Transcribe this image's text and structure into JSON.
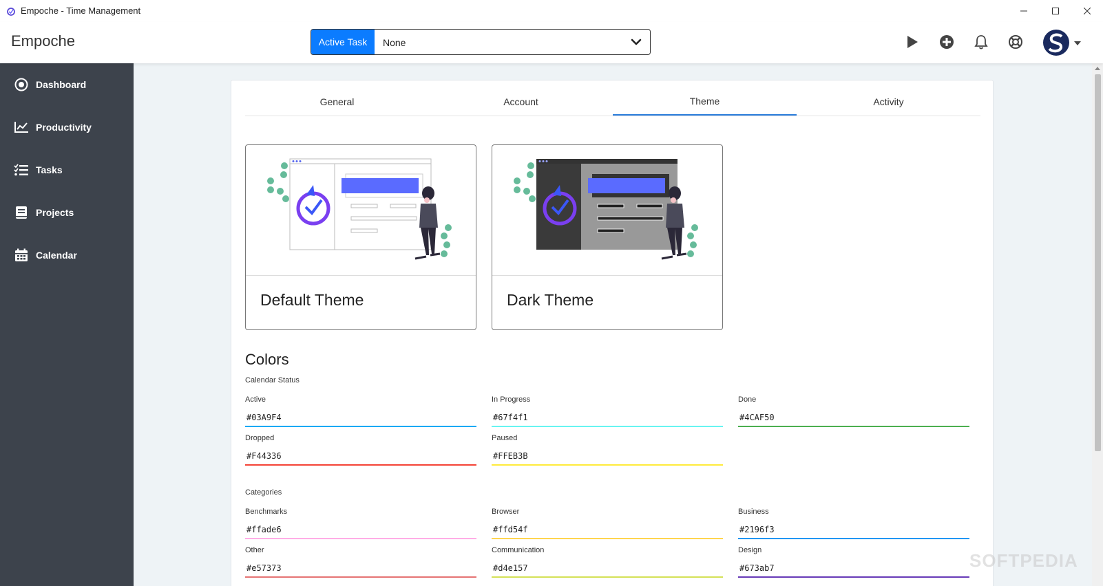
{
  "window": {
    "title": "Empoche - Time Management"
  },
  "header": {
    "brand": "Empoche",
    "active_task_label": "Active Task",
    "active_task_value": "None"
  },
  "sidebar": {
    "items": [
      {
        "label": "Dashboard",
        "icon": "dashboard-icon"
      },
      {
        "label": "Productivity",
        "icon": "chart-icon"
      },
      {
        "label": "Tasks",
        "icon": "list-icon"
      },
      {
        "label": "Projects",
        "icon": "book-icon"
      },
      {
        "label": "Calendar",
        "icon": "calendar-icon"
      }
    ]
  },
  "tabs": [
    {
      "label": "General"
    },
    {
      "label": "Account"
    },
    {
      "label": "Theme",
      "active": true
    },
    {
      "label": "Activity"
    }
  ],
  "themes": {
    "default": "Default Theme",
    "dark": "Dark Theme"
  },
  "colors": {
    "title": "Colors",
    "calendar_status_label": "Calendar Status",
    "status": [
      {
        "label": "Active",
        "value": "#03A9F4",
        "color": "#03A9F4"
      },
      {
        "label": "In Progress",
        "value": "#67f4f1",
        "color": "#67f4f1"
      },
      {
        "label": "Done",
        "value": "#4CAF50",
        "color": "#4CAF50"
      },
      {
        "label": "Dropped",
        "value": "#F44336",
        "color": "#F44336"
      },
      {
        "label": "Paused",
        "value": "#FFEB3B",
        "color": "#FFEB3B"
      }
    ],
    "categories_label": "Categories",
    "categories": [
      {
        "label": "Benchmarks",
        "value": "#ffade6",
        "color": "#ffade6"
      },
      {
        "label": "Browser",
        "value": "#ffd54f",
        "color": "#ffd54f"
      },
      {
        "label": "Business",
        "value": "#2196f3",
        "color": "#2196f3"
      },
      {
        "label": "Other",
        "value": "#e57373",
        "color": "#e57373"
      },
      {
        "label": "Communication",
        "value": "#d4e157",
        "color": "#d4e157"
      },
      {
        "label": "Design",
        "value": "#673ab7",
        "color": "#673ab7"
      }
    ]
  },
  "watermark": "SOFTPEDIA"
}
